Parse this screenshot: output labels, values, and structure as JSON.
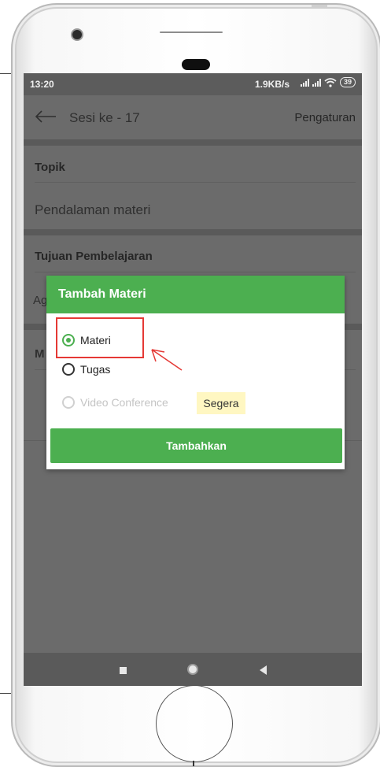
{
  "status_bar": {
    "time": "13:20",
    "network_rate": "1.9KB/s",
    "battery": "39"
  },
  "app_bar": {
    "title": "Sesi ke - 17",
    "action": "Pengaturan"
  },
  "content": {
    "topic_label": "Topik",
    "topic_value": "Pendalaman materi",
    "objective_label": "Tujuan Pembelajaran",
    "objective_value_partial": "Ag",
    "next_section_partial": "M"
  },
  "dialog": {
    "title": "Tambah Materi",
    "options": [
      {
        "label": "Materi",
        "selected": true,
        "enabled": true
      },
      {
        "label": "Tugas",
        "selected": false,
        "enabled": true
      },
      {
        "label": "Video Conference",
        "selected": false,
        "enabled": false
      }
    ],
    "coming_soon_badge": "Segera",
    "submit_label": "Tambahkan"
  },
  "colors": {
    "accent": "#4caf50",
    "highlight": "#e53935",
    "badge_bg": "#fff7c2",
    "overlay_bg": "#6b6b6b"
  },
  "icons": {
    "back": "arrow-left-icon",
    "nav_recent": "square-icon",
    "nav_home": "circle-icon",
    "nav_back": "triangle-back-icon"
  }
}
